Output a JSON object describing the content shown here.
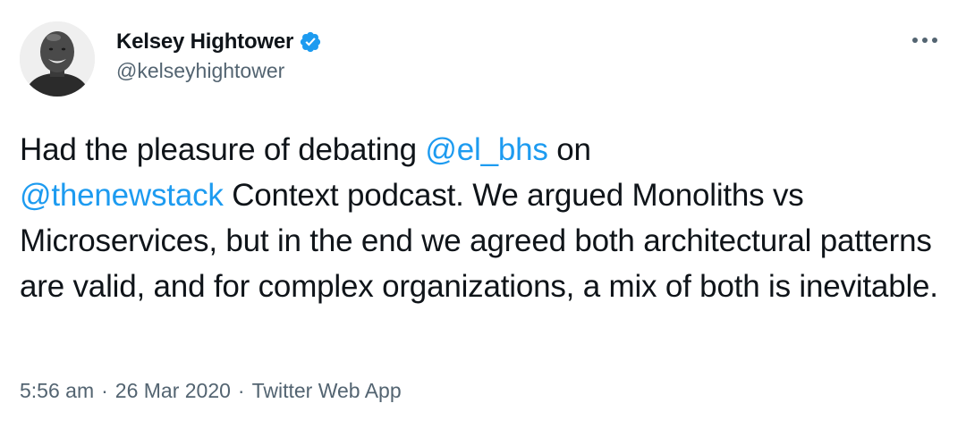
{
  "author": {
    "display_name": "Kelsey Hightower",
    "handle": "@kelseyhightower"
  },
  "icons": {
    "verified": "verified-badge-icon",
    "more": "more-horizontal-icon"
  },
  "colors": {
    "link": "#1d9bf0",
    "verified_badge": "#1d9bf0",
    "secondary_text": "#536471",
    "primary_text": "#0f1419"
  },
  "tweet": {
    "segments": [
      {
        "type": "text",
        "text": "Had the pleasure of debating "
      },
      {
        "type": "mention",
        "text": "@el_bhs"
      },
      {
        "type": "text",
        "text": " on "
      },
      {
        "type": "mention",
        "text": "@thenewstack"
      },
      {
        "type": "text",
        "text": " Context podcast. We argued Monoliths vs Microservices, but in the end we agreed both architectural patterns are valid, and for complex organizations, a mix of both is inevitable."
      }
    ]
  },
  "meta": {
    "time": "5:56 am",
    "separator": "·",
    "date": "26 Mar 2020",
    "source": "Twitter Web App"
  }
}
